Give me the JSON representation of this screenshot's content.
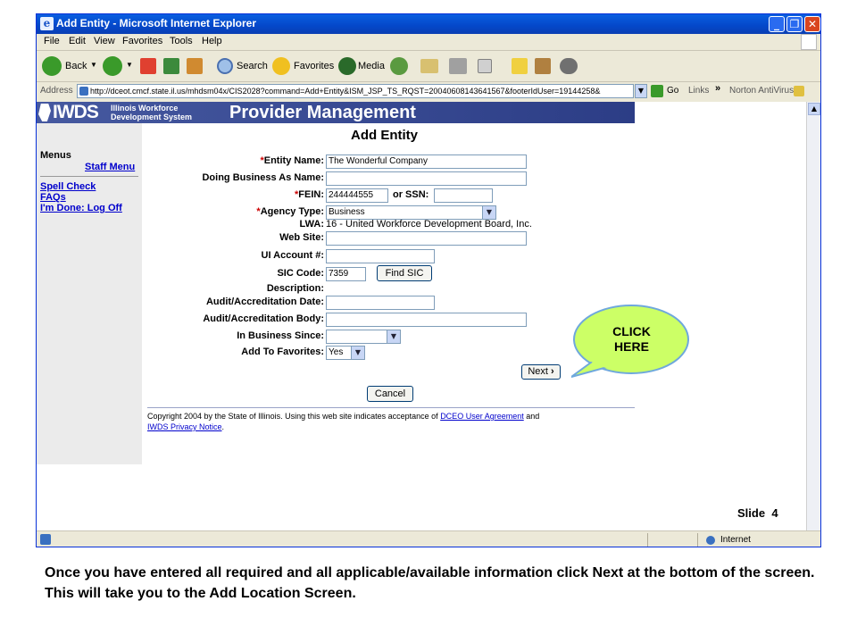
{
  "window": {
    "title": "Add Entity - Microsoft Internet Explorer",
    "menu": [
      "File",
      "Edit",
      "View",
      "Favorites",
      "Tools",
      "Help"
    ],
    "toolbar": {
      "back": "Back",
      "search": "Search",
      "favorites": "Favorites",
      "media": "Media"
    },
    "address": {
      "label": "Address",
      "url": "http://dceot.cmcf.state.il.us/mhdsm04x/CIS2028?command=Add+Entity&ISM_JSP_TS_RQST=20040608143641567&footerIdUser=19144258&",
      "go": "Go",
      "links": "Links",
      "links_chevron": "»",
      "norton": "Norton AntiVirus"
    },
    "status": {
      "zone": "Internet"
    }
  },
  "banner": {
    "logo": "IWDS",
    "org_line1": "Illinois Workforce",
    "org_line2": "Development System",
    "app_title": "Provider Management"
  },
  "sidebar": {
    "menus_heading": "Menus",
    "staff_menu": "Staff Menu",
    "links": [
      "Spell Check",
      "FAQs",
      "I'm Done: Log Off"
    ]
  },
  "form": {
    "heading": "Add Entity",
    "fields": {
      "entity_name": {
        "req": "*",
        "label": "Entity Name:",
        "value": "The Wonderful Company"
      },
      "dba": {
        "label": "Doing Business As Name:",
        "value": ""
      },
      "fein": {
        "req": "*",
        "label": "FEIN:",
        "value": "244444555"
      },
      "ssn": {
        "label": "or SSN:",
        "value": ""
      },
      "agency_type": {
        "req": "*",
        "label": "Agency Type:",
        "value": "Business"
      },
      "lwa": {
        "label": "LWA:",
        "value": "16 - United Workforce Development Board, Inc."
      },
      "web_site": {
        "label": "Web Site:",
        "value": ""
      },
      "ui_account": {
        "label": "UI Account #:",
        "value": ""
      },
      "sic_code": {
        "label": "SIC Code:",
        "value": "7359"
      },
      "description": {
        "label": "Description:",
        "value": ""
      },
      "audit_date": {
        "label": "Audit/Accreditation Date:",
        "value": ""
      },
      "audit_body": {
        "label": "Audit/Accreditation Body:",
        "value": ""
      },
      "in_business_since": {
        "label": "In Business Since:",
        "value": ""
      },
      "add_to_favorites": {
        "label": "Add To Favorites:",
        "value": "Yes"
      }
    },
    "find_sic": "Find SIC",
    "next": "Next",
    "next_arrow": "›",
    "cancel": "Cancel"
  },
  "footer": {
    "copyright": "Copyright 2004 by the State of Illinois. Using this web site indicates acceptance of ",
    "agreement_link": "DCEO User Agreement",
    "and": " and",
    "privacy_link": "IWDS Privacy Notice",
    "period": "."
  },
  "callout": {
    "line1": "CLICK",
    "line2": "HERE"
  },
  "slide": {
    "label": "Slide",
    "number": "4"
  },
  "caption": "Once you have entered all required and all applicable/available information click Next at the bottom of the screen.  This will take you to the Add Location Screen.",
  "colors": {
    "title_bar": "#0a5fe0",
    "banner": "#2c3d86",
    "callout_fill": "#ccff66",
    "callout_stroke": "#6fa8dc",
    "required": "#cc0000",
    "link": "#0000cc"
  }
}
